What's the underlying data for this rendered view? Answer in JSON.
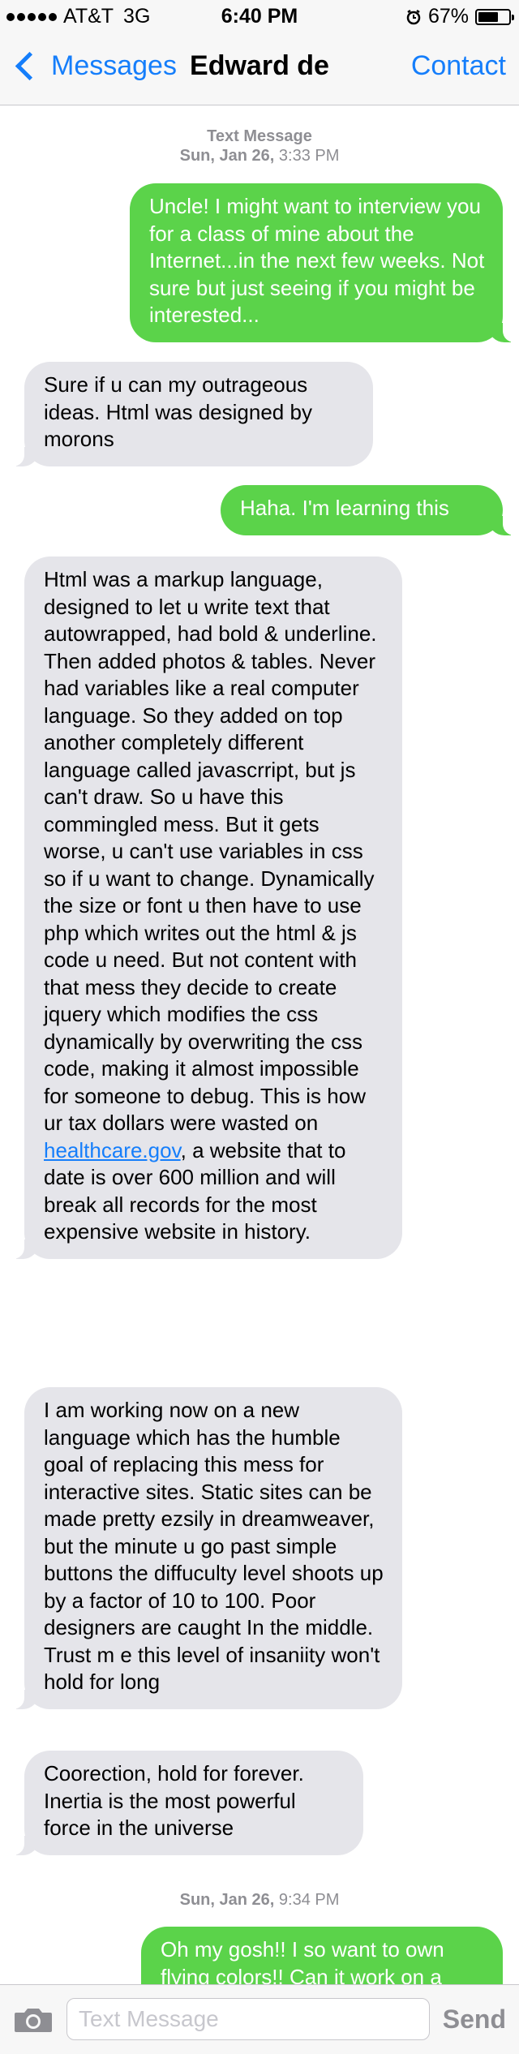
{
  "status_bar": {
    "carrier": "AT&T",
    "network": "3G",
    "time": "6:40 PM",
    "battery_percent": "67%",
    "battery_level": 0.67
  },
  "nav": {
    "back_label": "Messages",
    "title": "Edward de",
    "contact_label": "Contact"
  },
  "thread": {
    "header_label": "Text Message",
    "header_date": "Sun, Jan 26,",
    "header_time": "3:33 PM",
    "messages": [
      {
        "dir": "out",
        "text": "Uncle! I might want to interview you for a class of mine about the Internet...in the next few weeks. Not sure but just seeing if you might be interested..."
      },
      {
        "dir": "in",
        "text": "Sure if u can my outrageous ideas. Html was designed by morons"
      },
      {
        "dir": "out",
        "text": "Haha. I'm learning this"
      },
      {
        "dir": "in",
        "text_before": "Html was a markup language, designed to let u write text that autowrapped, had bold & underline. Then added photos & tables. Never had variables like a real computer language. So they added on top another completely different language called javascrript, but js can't draw. So u have this commingled mess. But it gets worse, u can't use variables in css so if u want to change. Dynamically the size or font u then have to use php which writes out the html & js code u need. But not content with that mess they decide to create jquery which modifies the css dynamically by overwriting the css code, making it almost impossible for someone to debug. This is how ur tax dollars were wasted on ",
        "link": "healthcare.gov",
        "text_after": ", a website that to date is over 600 million and will break all records for the most expensive website in history."
      },
      {
        "dir": "in",
        "text": "I am working now on a new language which has the humble goal of replacing this mess for interactive sites. Static sites can be made pretty ezsily in dreamweaver, but the minute u go past simple buttons the diffuculty level shoots up by a factor of 10 to 100. Poor designers are caught In the middle. Trust m e this level of insaniity won't hold for long"
      },
      {
        "dir": "in",
        "text": "Coorection, hold for forever. Inertia is the most powerful force in the universe"
      }
    ],
    "second_date": "Sun, Jan 26,",
    "second_time": "9:34 PM",
    "last_message": "Oh my gosh!! I so want to own flying colors!! Can it work on a"
  },
  "input_bar": {
    "placeholder": "Text Message",
    "send_label": "Send"
  },
  "colors": {
    "ios_blue": "#157efb",
    "outgoing_green": "#5bd34a",
    "incoming_gray": "#e5e5ea"
  }
}
